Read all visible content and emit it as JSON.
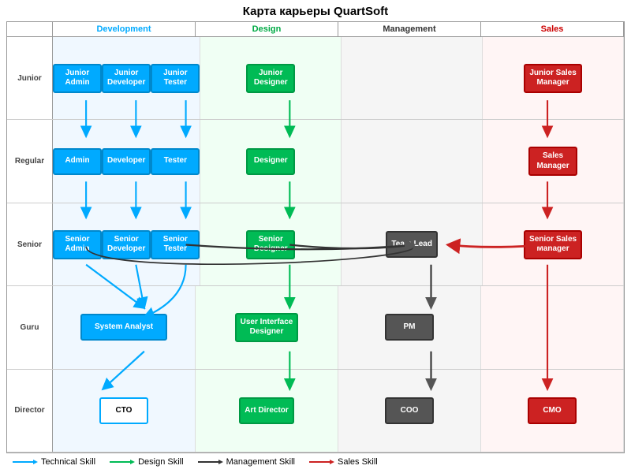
{
  "title": "Карта карьеры QuartSoft",
  "columns": {
    "dev": "Development",
    "design": "Design",
    "mgmt": "Management",
    "sales": "Sales"
  },
  "rows": {
    "junior": "Junior",
    "regular": "Regular",
    "senior": "Senior",
    "guru": "Guru",
    "director": "Director"
  },
  "boxes": {
    "junior_admin": "Junior\nAdmin",
    "junior_developer": "Junior\nDeveloper",
    "junior_tester": "Junior\nTester",
    "junior_designer": "Junior\nDesigner",
    "junior_sales_manager": "Junior Sales\nManager",
    "admin": "Admin",
    "developer": "Developer",
    "tester": "Tester",
    "designer": "Designer",
    "sales_manager": "Sales\nManager",
    "senior_admin": "Senior\nAdmin",
    "senior_developer": "Senior\nDeveloper",
    "senior_tester": "Senior\nTester",
    "senior_designer": "Senior\nDesigner",
    "team_lead": "Team Lead",
    "senior_sales_manager": "Senior Sales\nManager",
    "system_analyst": "System Analyst",
    "ui_designer": "User Interface\nDesigner",
    "pm": "PM",
    "cto": "CTO",
    "art_director": "Art Director",
    "coo": "COO",
    "cmo": "CMO"
  },
  "legend": {
    "technical": "Technical Skill",
    "design": "Design Skill",
    "management": "Management Skill",
    "sales": "Sales Skill"
  },
  "colors": {
    "blue": "#00aaff",
    "green": "#00bb55",
    "dark": "#555555",
    "red": "#cc2222"
  }
}
